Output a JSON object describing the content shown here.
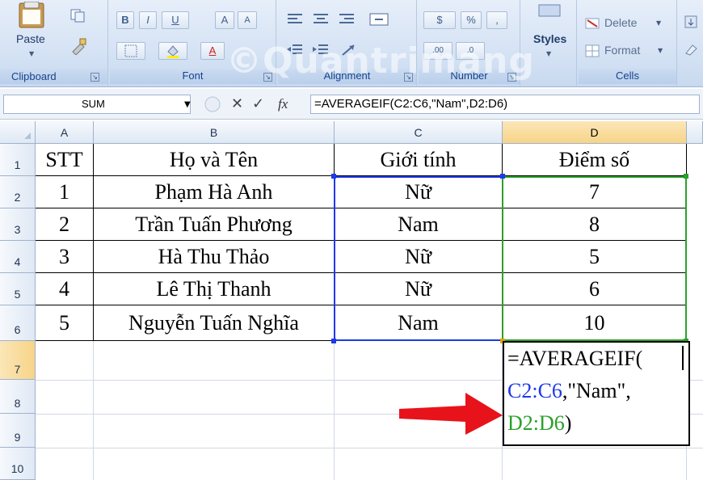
{
  "ribbon": {
    "clipboard": {
      "paste_label": "Paste",
      "group_label": "Clipboard"
    },
    "font": {
      "bold": "B",
      "italic": "I",
      "underline": "U",
      "grow": "A",
      "shrink": "A",
      "font_color": "A",
      "group_label": "Font"
    },
    "alignment": {
      "group_label": "Alignment"
    },
    "number": {
      "currency": "$",
      "percent": "%",
      "comma": ",",
      "inc_decimal": ".00",
      "dec_decimal": ".0",
      "group_label": "Number"
    },
    "styles": {
      "label": "Styles"
    },
    "cells": {
      "delete_label": "Delete",
      "format_label": "Format",
      "group_label": "Cells"
    }
  },
  "formula_bar": {
    "name_box": "SUM",
    "cancel_icon": "✕",
    "enter_icon": "✓",
    "fx_label": "fx",
    "formula": "=AVERAGEIF(C2:C6,\"Nam\",D2:D6)"
  },
  "columns": [
    "A",
    "B",
    "C",
    "D"
  ],
  "rows": [
    "1",
    "2",
    "3",
    "4",
    "5",
    "6",
    "7",
    "8",
    "9",
    "10"
  ],
  "table": {
    "header": [
      "STT",
      "Họ và Tên",
      "Giới tính",
      "Điểm số"
    ],
    "data": [
      [
        "1",
        "Phạm Hà Anh",
        "Nữ",
        "7"
      ],
      [
        "2",
        "Trần Tuấn Phương",
        "Nam",
        "8"
      ],
      [
        "3",
        "Hà Thu Thảo",
        "Nữ",
        "5"
      ],
      [
        "4",
        "Lê Thị Thanh",
        "Nữ",
        "6"
      ],
      [
        "5",
        "Nguyễn Tuấn Nghĩa",
        "Nam",
        "10"
      ]
    ]
  },
  "edit_cell": {
    "line1": "=AVERAGEIF(",
    "line2_ref": "C2:C6",
    "line2_rest": ",\"Nam\",",
    "line3_ref": "D2:D6",
    "line3_rest": ")"
  },
  "colors": {
    "ref_blue": "#1f39e8",
    "ref_green": "#2aa12a",
    "arrow_red": "#e8131a",
    "ribbon_text": "#15428b"
  }
}
